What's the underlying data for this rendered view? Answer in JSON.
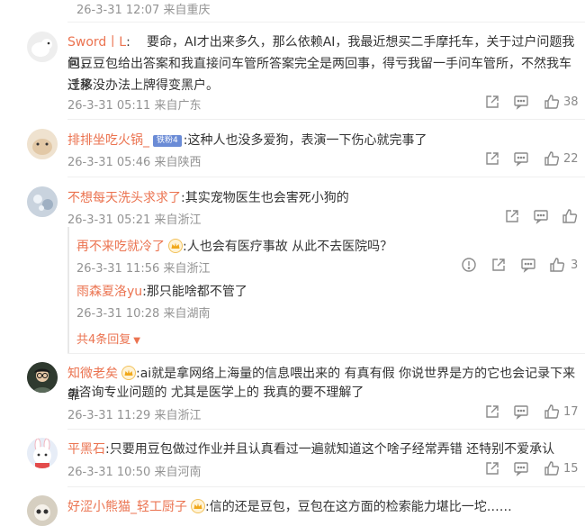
{
  "top_comment_meta": "26-3-31 12:07 来自重庆",
  "comments": [
    {
      "name": "Sword丨L",
      "text_lines": [
        "要命，AI才出来多久，那么依赖AI，我最近想买二手摩托车，关于过户问题我问豆",
        "包，豆包给出答案和我直接问车管所答案完全是两回事，得亏我留一手问车管所，不然我车迁移",
        "过来没办法上牌得变黑户。"
      ],
      "meta": "26-3-31 05:11 来自广东",
      "likes": "38"
    },
    {
      "name": "排排坐吃火锅_",
      "badge": "铁粉4",
      "text": "这种人也没多爱狗，表演一下伤心就完事了",
      "meta": "26-3-31 05:46 来自陕西",
      "likes": "22"
    },
    {
      "name": "不想每天洗头求求了",
      "text": "其实宠物医生也会害死小狗的",
      "meta": "26-3-31 05:21 来自浙江",
      "replies": [
        {
          "name": "再不来吃就冷了",
          "text": "人也会有医疗事故 从此不去医院吗？",
          "meta": "26-3-31 11:56 来自浙江",
          "likes": "3"
        },
        {
          "name": "雨森夏洛yu",
          "text": "那只能啥都不管了",
          "meta": "26-3-31 10:28 来自湖南"
        }
      ],
      "more_replies": "共4条回复"
    },
    {
      "name": "知微老矣",
      "text_lines": [
        "ai就是拿网络上海量的信息喂出来的 有真有假 你说世界是方的它也会记录下来 靠",
        "ai咨询专业问题的 尤其是医学上的 我真的要不理解了"
      ],
      "meta": "26-3-31 11:29 来自浙江",
      "likes": "17"
    },
    {
      "name": "平黑石",
      "text": "只要用豆包做过作业并且认真看过一遍就知道这个啥子经常弄错 还特别不爱承认",
      "meta": "26-3-31 10:50 来自河南",
      "likes": "15"
    },
    {
      "name": "好涩小熊猫_轻工厨子",
      "text": "信的还是豆包，豆包在这方面的检索能力堪比一坨……"
    }
  ],
  "colors": {
    "name": "#eb7350",
    "meta": "#939393",
    "text": "#333333",
    "badge": "#6a8bd6"
  },
  "icons": [
    "share-icon",
    "comment-icon",
    "like-icon",
    "report-icon"
  ]
}
